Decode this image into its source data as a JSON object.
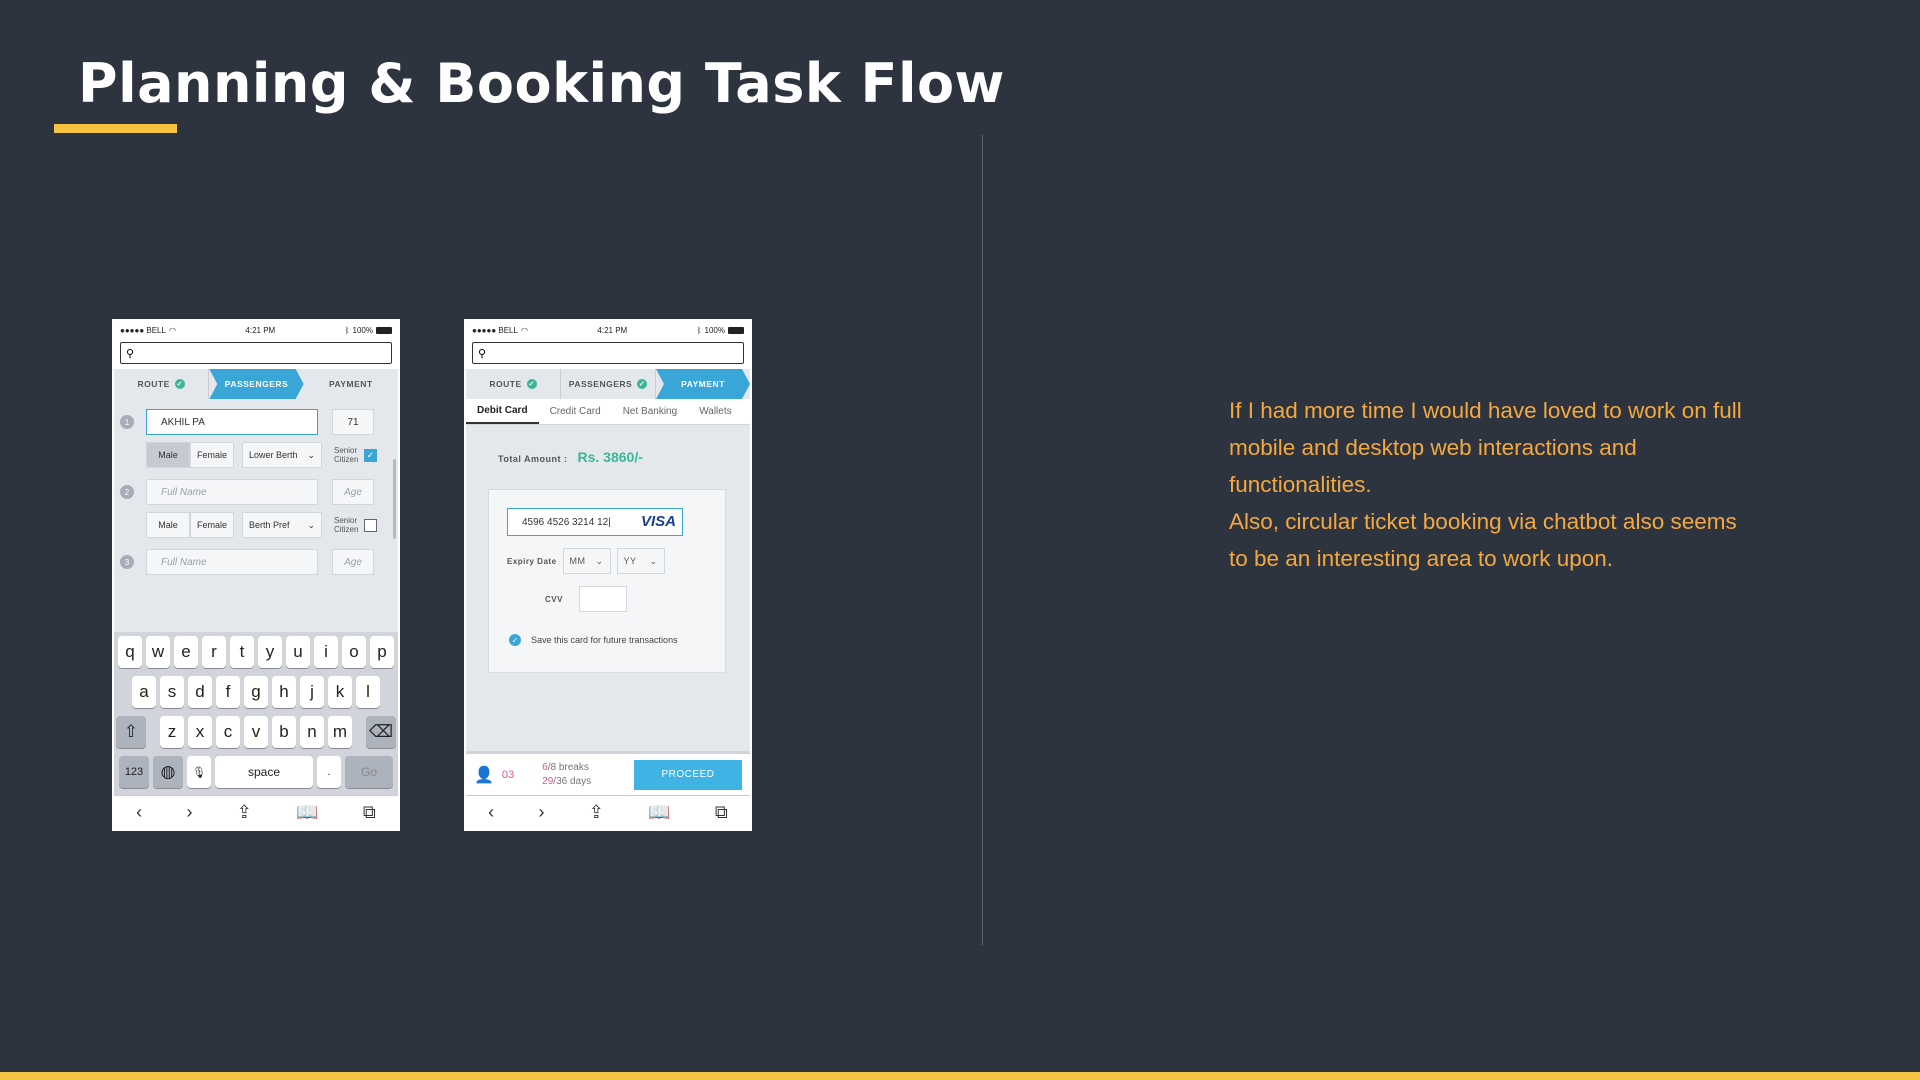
{
  "slide": {
    "title": "Planning & Booking Task Flow",
    "description_lines": [
      "If I had more time I would have loved to work on full mobile and desktop web interactions and functionalities.",
      "Also, circular ticket booking via chatbot also seems to be an interesting area to work upon."
    ],
    "colors": {
      "background": "#2d333f",
      "accent": "#f5c242",
      "description_text": "#f3a93d"
    }
  },
  "phone1": {
    "status": {
      "carrier": "●●●●● BELL",
      "time": "4:21 PM",
      "battery": "100%"
    },
    "steps": [
      "ROUTE",
      "PASSENGERS",
      "PAYMENT"
    ],
    "passengers": [
      {
        "num": "1",
        "name": "AKHIL PA",
        "age": "71",
        "gender_male": "Male",
        "gender_female": "Female",
        "berth": "Lower Berth",
        "senior": "Senior Citizen",
        "senior_checked": true
      },
      {
        "num": "2",
        "name_placeholder": "Full Name",
        "age_placeholder": "Age",
        "gender_male": "Male",
        "gender_female": "Female",
        "berth": "Berth Pref",
        "senior": "Senior Citizen",
        "senior_checked": false
      },
      {
        "num": "3",
        "name_placeholder": "Full Name",
        "age_placeholder": "Age"
      }
    ],
    "keyboard": {
      "row1": [
        "q",
        "w",
        "e",
        "r",
        "t",
        "y",
        "u",
        "i",
        "o",
        "p"
      ],
      "row2": [
        "a",
        "s",
        "d",
        "f",
        "g",
        "h",
        "j",
        "k",
        "l"
      ],
      "row3": [
        "z",
        "x",
        "c",
        "v",
        "b",
        "n",
        "m"
      ],
      "num": "123",
      "space": "space",
      "dot": ".",
      "go": "Go"
    }
  },
  "phone2": {
    "status": {
      "carrier": "●●●●● BELL",
      "time": "4:21 PM",
      "battery": "100%"
    },
    "steps": [
      "ROUTE",
      "PASSENGERS",
      "PAYMENT"
    ],
    "tabs": [
      "Debit Card",
      "Credit Card",
      "Net Banking",
      "Wallets"
    ],
    "total_label": "Total Amount :",
    "total_amount": "Rs. 3860/-",
    "card_number": "4596  4526  3214  12|",
    "card_brand": "VISA",
    "expiry_label": "Expiry Date",
    "expiry_month": "MM",
    "expiry_year": "YY",
    "cvv_label": "CVV",
    "save_label": "Save this card for future transactions",
    "passenger_count": "03",
    "breaks_num": "6",
    "breaks_text": "/8 breaks",
    "days_num": "29",
    "days_text": "/36 days",
    "proceed": "PROCEED"
  }
}
